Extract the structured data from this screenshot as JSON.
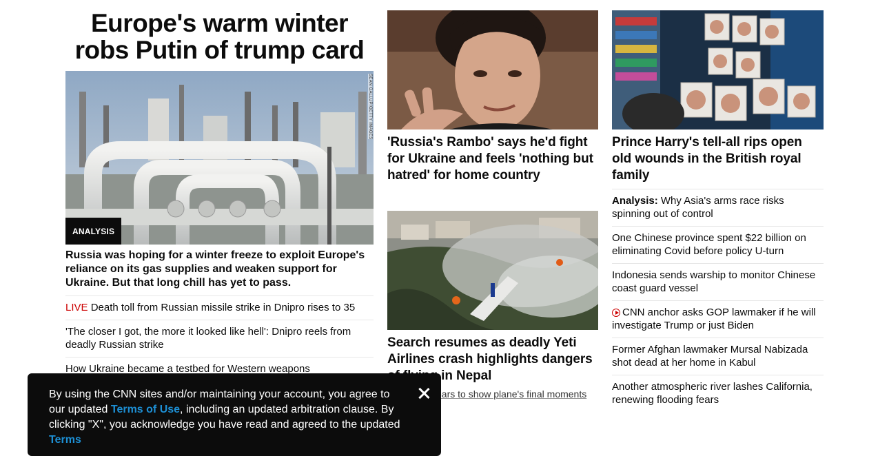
{
  "lead": {
    "headline": "Europe's warm winter robs Putin of trump card",
    "image_credit": "SEAN GALLUP/GETTY IMAGES",
    "badge": "ANALYSIS",
    "description": "Russia was hoping for a winter freeze to exploit Europe's reliance on its gas supplies and weaken support for Ukraine. But that long chill has yet to pass.",
    "related": [
      {
        "live_label": "LIVE",
        "text": " Death toll from Russian missile strike in Dnipro rises to 35"
      },
      {
        "text": "'The closer I got, the more it looked like hell': Dnipro reels from deadly Russian strike"
      },
      {
        "text": "How Ukraine became a testbed for Western weapons"
      }
    ]
  },
  "middle": {
    "story_a": {
      "headline": "'Russia's Rambo' says he'd fight for Ukraine and feels 'nothing but hatred' for home country"
    },
    "story_b": {
      "headline": "Search resumes as deadly Yeti Airlines crash highlights dangers of flying in Nepal",
      "sub_link": "ears to show plane's final moments"
    }
  },
  "right": {
    "story_c": {
      "headline": "Prince Harry's tell-all rips open old wounds in the British royal family"
    },
    "list": [
      {
        "prefix": "Analysis:",
        "text": " Why Asia's arms race risks spinning out of control"
      },
      {
        "text": "One Chinese province spent $22 billion on eliminating Covid before policy U-turn"
      },
      {
        "text": "Indonesia sends warship to monitor Chinese coast guard vessel"
      },
      {
        "icon": "play-video-icon",
        "text": "CNN anchor asks GOP lawmaker if he will investigate Trump or just Biden"
      },
      {
        "text": "Former Afghan lawmaker Mursal Nabizada shot dead at her home in Kabul"
      },
      {
        "text": "Another atmospheric river lashes California, renewing flooding fears"
      }
    ]
  },
  "banner": {
    "text_1": "By using the CNN sites and/or maintaining your account, you agree to our updated ",
    "link_1": "Terms of Use",
    "text_2": ", including an updated arbitration clause. By clicking \"X\", you acknowledge you have read and agreed to the updated ",
    "link_2": "Terms",
    "close_icon": "close-icon"
  },
  "colors": {
    "live": "#cc0000",
    "link": "#1d8fd4",
    "banner_bg": "#0c0c0c"
  }
}
